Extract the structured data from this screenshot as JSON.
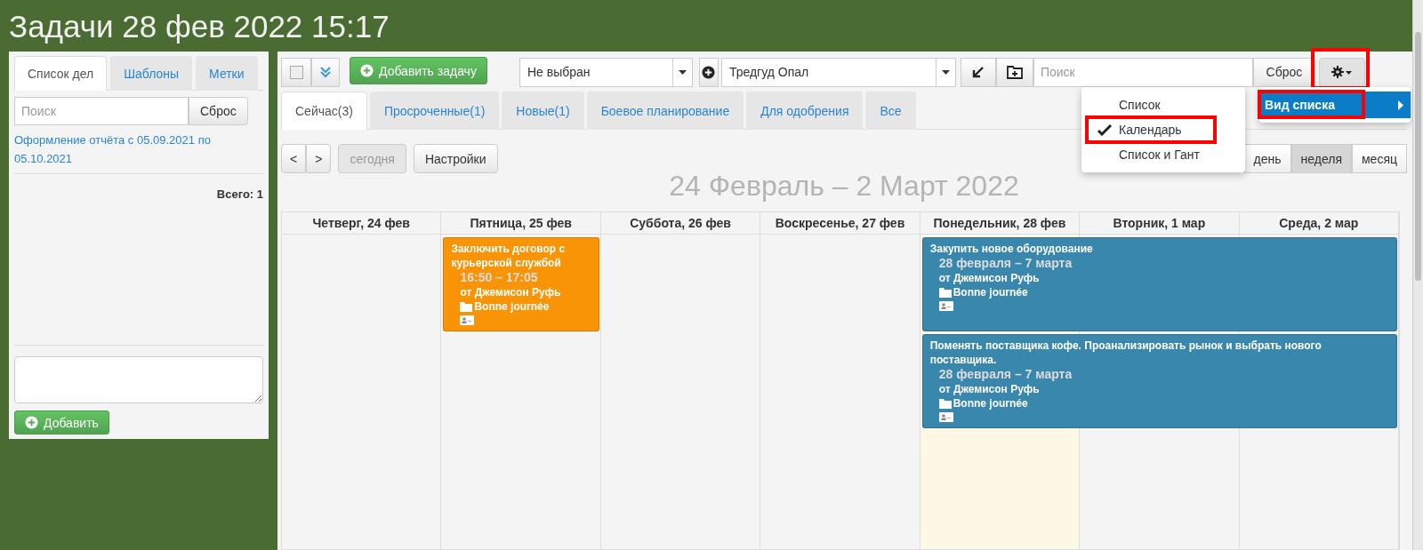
{
  "page_title": "Задачи 28 фев 2022 15:17",
  "sidebar": {
    "tabs": [
      {
        "label": "Список дел",
        "selected": true
      },
      {
        "label": "Шаблоны",
        "selected": false
      },
      {
        "label": "Метки",
        "selected": false
      }
    ],
    "search": {
      "placeholder": "Поиск",
      "reset": "Сброс"
    },
    "link": "Оформление отчёта с 05.09.2021 по 05.10.2021",
    "total": "Всего: 1",
    "add_button": "Добавить"
  },
  "toolbar": {
    "select_all": {
      "checked": false
    },
    "add_task": "Добавить задачу",
    "filter_select": "Не выбран",
    "user_select": "Тредгуд Опал",
    "search": {
      "placeholder": "Поиск",
      "reset": "Сброс"
    }
  },
  "tabs": [
    {
      "label": "Сейчас(3)",
      "selected": true
    },
    {
      "label": "Просроченные(1)",
      "selected": false
    },
    {
      "label": "Новые(1)",
      "selected": false
    },
    {
      "label": "Боевое планирование",
      "selected": false
    },
    {
      "label": "Для одобрения",
      "selected": false
    },
    {
      "label": "Все",
      "selected": false
    }
  ],
  "calendar": {
    "prev": "<",
    "next": ">",
    "today": "сегодня",
    "settings": "Настройки",
    "range_title": "24 Февраль – 2 Март 2022",
    "views": [
      {
        "label": "день",
        "selected": false
      },
      {
        "label": "неделя",
        "selected": true
      },
      {
        "label": "месяц",
        "selected": false
      }
    ],
    "days": [
      {
        "label": "Четверг, 24 фев",
        "today": false
      },
      {
        "label": "Пятница, 25 фев",
        "today": false,
        "events": [
          {
            "kind": "single",
            "color": "#f89406",
            "title": "Заключить договор с курьерской службой",
            "time": "16:50 – 17:05",
            "author": "от Джемисон Руфь",
            "project": "Bonne journée"
          }
        ]
      },
      {
        "label": "Суббота, 26 фев",
        "today": false
      },
      {
        "label": "Воскресенье, 27 фев",
        "today": false
      },
      {
        "label": "Понедельник, 28 фев",
        "today": true,
        "events": [
          {
            "kind": "continuing",
            "color": "#3a87ad",
            "title": "Закупить новое оборудование",
            "time": "28 февраля – 7 марта",
            "author": "от Джемисон Руфь",
            "project": "Bonne journée"
          },
          {
            "kind": "continuing",
            "color": "#3a87ad",
            "title": "Поменять поставщика кофе. Проанализировать рынок и выбрать нового поставщика.",
            "time": "28 февраля – 7 марта",
            "author": "от Джемисон Руфь",
            "project": "Bonne journée"
          }
        ]
      },
      {
        "label": "Вторник, 1 мар",
        "today": false
      },
      {
        "label": "Среда, 2 мар",
        "today": false
      }
    ]
  },
  "settings_menu": {
    "item": "Вид списка",
    "submenu": [
      {
        "label": "Список",
        "selected": false
      },
      {
        "label": "Календарь",
        "selected": true
      },
      {
        "label": "Список и Гант",
        "selected": false
      }
    ]
  }
}
